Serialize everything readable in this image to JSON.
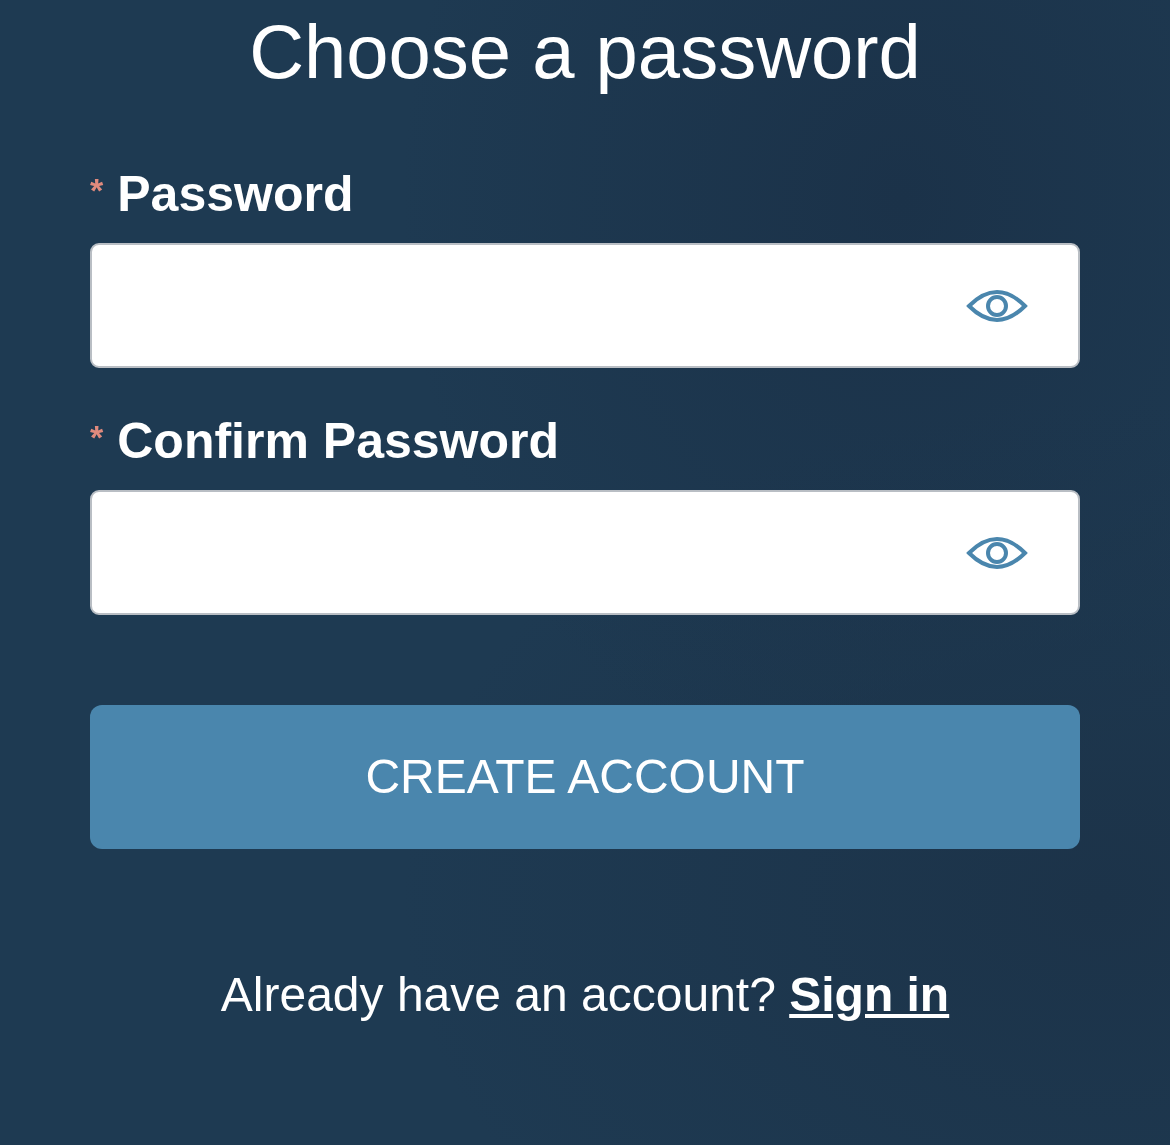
{
  "title": "Choose a password",
  "fields": [
    {
      "required_mark": "*",
      "label": "Password"
    },
    {
      "required_mark": "*",
      "label": "Confirm Password"
    }
  ],
  "button": "CREATE ACCOUNT",
  "footer": {
    "text": "Already have an account?",
    "link": "Sign in"
  }
}
